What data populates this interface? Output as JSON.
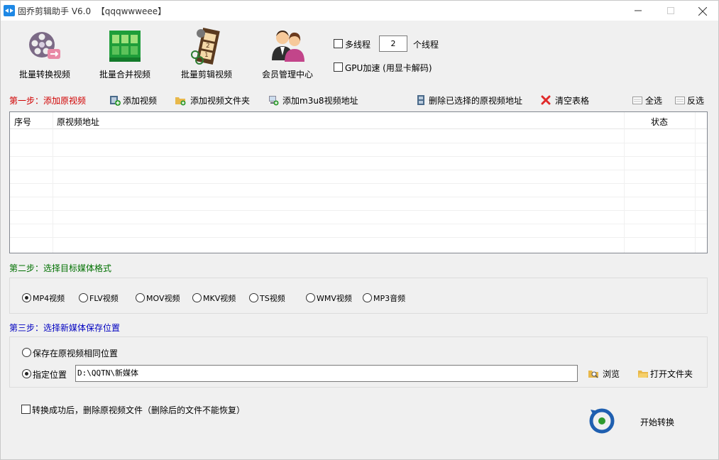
{
  "titlebar": {
    "title": "固乔剪辑助手 V6.0  【qqqwwweee】"
  },
  "toolbar": {
    "items": [
      {
        "label": "批量转换视频",
        "icon": "film-reel-icon"
      },
      {
        "label": "批量合并视频",
        "icon": "merge-grid-icon"
      },
      {
        "label": "批量剪辑视频",
        "icon": "film-strip-icon"
      },
      {
        "label": "会员管理中心",
        "icon": "users-icon"
      }
    ],
    "multithread_label": "多线程",
    "thread_count": "2",
    "thread_unit": "个线程",
    "gpu_label": "GPU加速 (用显卡解码)"
  },
  "step1": {
    "title": "第一步：添加原视频",
    "add_video": "添加视频",
    "add_folder": "添加视频文件夹",
    "add_m3u8": "添加m3u8视频地址",
    "delete_selected": "删除已选择的原视频地址",
    "clear_table": "清空表格",
    "select_all": "全选",
    "invert": "反选"
  },
  "table": {
    "columns": [
      "序号",
      "原视频地址",
      "状态"
    ],
    "rows": []
  },
  "step2": {
    "title": "第二步：选择目标媒体格式",
    "formats": [
      "MP4视频",
      "FLV视频",
      "MOV视频",
      "MKV视频",
      "TS视频",
      "WMV视频",
      "MP3音频"
    ],
    "selected": "MP4视频"
  },
  "step3": {
    "title": "第三步：选择新媒体保存位置",
    "same_location": "保存在原视频相同位置",
    "custom_location": "指定位置",
    "path": "D:\\QQTN\\新媒体",
    "browse": "浏览",
    "open_folder": "打开文件夹"
  },
  "footer": {
    "delete_after": "转换成功后，删除原视频文件（删除后的文件不能恢复）",
    "start": "开始转换"
  },
  "colors": {
    "step1": "#d00000",
    "step2": "#007000",
    "step3": "#0000c0",
    "accent": "#1e88e5"
  }
}
